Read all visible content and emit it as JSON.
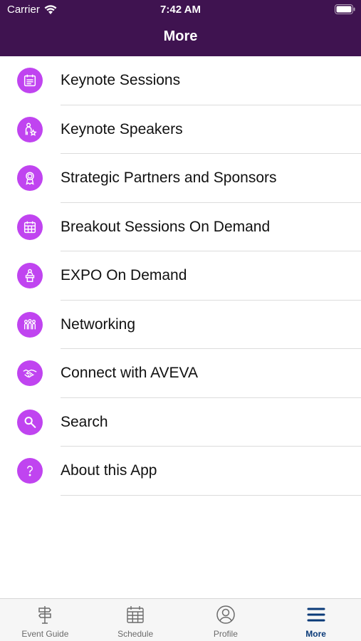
{
  "status_bar": {
    "carrier": "Carrier",
    "time": "7:42 AM"
  },
  "header": {
    "title": "More"
  },
  "menu": {
    "items": [
      {
        "label": "Keynote Sessions",
        "icon": "calendar-list-icon"
      },
      {
        "label": "Keynote Speakers",
        "icon": "speaker-star-icon"
      },
      {
        "label": "Strategic Partners and Sponsors",
        "icon": "award-ribbon-icon"
      },
      {
        "label": "Breakout Sessions On Demand",
        "icon": "calendar-grid-icon"
      },
      {
        "label": "EXPO On Demand",
        "icon": "podium-icon"
      },
      {
        "label": "Networking",
        "icon": "people-group-icon"
      },
      {
        "label": "Connect with AVEVA",
        "icon": "handshake-icon"
      },
      {
        "label": "Search",
        "icon": "search-icon"
      },
      {
        "label": "About this App",
        "icon": "question-icon"
      }
    ]
  },
  "tabbar": {
    "tabs": [
      {
        "label": "Event Guide",
        "icon": "signpost-icon",
        "active": false
      },
      {
        "label": "Schedule",
        "icon": "calendar-icon",
        "active": false
      },
      {
        "label": "Profile",
        "icon": "profile-icon",
        "active": false
      },
      {
        "label": "More",
        "icon": "hamburger-menu-icon",
        "active": true
      }
    ]
  },
  "colors": {
    "header": "#3f1350",
    "icon_circle": "#c044f0",
    "active_tab": "#0a3a78"
  }
}
